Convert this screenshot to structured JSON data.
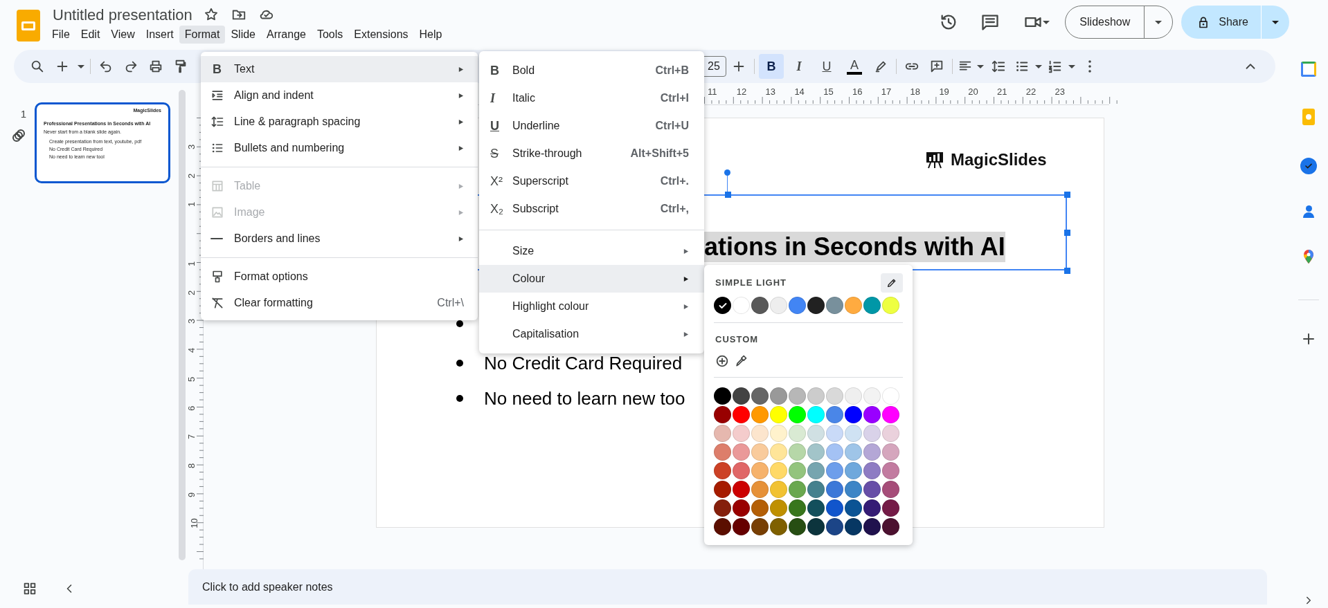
{
  "app": {
    "title": "Untitled presentation"
  },
  "menu_bar": [
    {
      "label": "File",
      "selected": false
    },
    {
      "label": "Edit",
      "selected": false
    },
    {
      "label": "View",
      "selected": false
    },
    {
      "label": "Insert",
      "selected": false
    },
    {
      "label": "Format",
      "selected": true
    },
    {
      "label": "Slide",
      "selected": false
    },
    {
      "label": "Arrange",
      "selected": false
    },
    {
      "label": "Tools",
      "selected": false
    },
    {
      "label": "Extensions",
      "selected": false
    },
    {
      "label": "Help",
      "selected": false
    }
  ],
  "header": {
    "slideshow_label": "Slideshow",
    "share_label": "Share"
  },
  "toolbar": {
    "font_size": "25",
    "format_buttons": [
      {
        "glyph": "B",
        "selected": true
      },
      {
        "glyph": "I",
        "selected": false
      },
      {
        "glyph": "U",
        "selected": false
      },
      {
        "glyph": "A",
        "selected": false
      }
    ]
  },
  "filmstrip": {
    "slides": [
      {
        "number": "1",
        "selected": true,
        "logo": "MagicSlides",
        "title": "Professional Presentations in Seconds with AI",
        "subtitle": "Never start from a blank slide again.",
        "bullets": [
          "Create presentation from text, youtube, pdf",
          "No Credit Card Required",
          "No need to learn new tool"
        ]
      }
    ]
  },
  "rulers": {
    "horizontal": [
      "11",
      "12",
      "13",
      "14",
      "15",
      "16",
      "17",
      "18",
      "19",
      "20",
      "21",
      "22",
      "23"
    ],
    "vertical_above": [
      "3",
      "2",
      "1"
    ],
    "vertical_below": [
      "1",
      "2",
      "3",
      "4",
      "5",
      "6",
      "7",
      "8",
      "9",
      "10"
    ]
  },
  "slide": {
    "logo": "MagicSlides",
    "title": {
      "text": "ations in Seconds with AI",
      "selected": true
    },
    "bullets": [
      {
        "kind": "covered"
      },
      {
        "kind": "text",
        "text": "No Credit Card Required"
      },
      {
        "kind": "text",
        "text": "No need to learn new too"
      }
    ]
  },
  "format_menu": {
    "groups": [
      [
        {
          "label": "Text",
          "glyph": "B",
          "submenu": true,
          "disabled": false,
          "selected": true
        },
        {
          "label": "Align and indent",
          "submenu": true,
          "disabled": false,
          "selected": false
        },
        {
          "label": "Line & paragraph spacing",
          "submenu": true,
          "disabled": false,
          "selected": false
        },
        {
          "label": "Bullets and numbering",
          "submenu": true,
          "disabled": false,
          "selected": false
        }
      ],
      [
        {
          "label": "Table",
          "submenu": true,
          "disabled": true,
          "selected": false
        },
        {
          "label": "Image",
          "submenu": true,
          "disabled": true,
          "selected": false
        },
        {
          "label": "Borders and lines",
          "submenu": true,
          "disabled": false,
          "selected": false
        }
      ],
      [
        {
          "label": "Format options",
          "submenu": false,
          "disabled": false,
          "selected": false
        },
        {
          "label": "Clear formatting",
          "shortcut": "Ctrl+\\",
          "submenu": false,
          "disabled": false,
          "selected": false
        }
      ]
    ]
  },
  "text_submenu": {
    "groups": [
      [
        {
          "label": "Bold",
          "glyph": "B",
          "shortcut": "Ctrl+B",
          "submenu": false,
          "selected": false
        },
        {
          "label": "Italic",
          "glyph": "I",
          "shortcut": "Ctrl+I",
          "submenu": false,
          "selected": false
        },
        {
          "label": "Underline",
          "glyph": "U",
          "shortcut": "Ctrl+U",
          "submenu": false,
          "selected": false
        },
        {
          "label": "Strike-through",
          "glyph": "S",
          "shortcut": "Alt+Shift+5",
          "submenu": false,
          "selected": false
        },
        {
          "label": "Superscript",
          "glyph": "X²",
          "shortcut": "Ctrl+.",
          "submenu": false,
          "selected": false
        },
        {
          "label": "Subscript",
          "glyph": "X₂",
          "shortcut": "Ctrl+,",
          "submenu": false,
          "selected": false
        }
      ],
      [
        {
          "label": "Size",
          "submenu": true,
          "selected": false
        },
        {
          "label": "Colour",
          "submenu": true,
          "selected": true
        },
        {
          "label": "Highlight colour",
          "submenu": true,
          "selected": false
        },
        {
          "label": "Capitalisation",
          "submenu": true,
          "selected": false
        }
      ]
    ]
  },
  "colour_palette": {
    "theme_label": "SIMPLE LIGHT",
    "theme_colours": [
      {
        "color": "#000000",
        "selected": true
      },
      {
        "color": "#ffffff",
        "selected": false
      },
      {
        "color": "#595959",
        "selected": false
      },
      {
        "color": "#eeeeee",
        "selected": false
      },
      {
        "color": "#4285f4",
        "selected": false
      },
      {
        "color": "#212121",
        "selected": false
      },
      {
        "color": "#78909c",
        "selected": false
      },
      {
        "color": "#ffab40",
        "selected": false
      },
      {
        "color": "#0097a7",
        "selected": false
      },
      {
        "color": "#eeff41",
        "selected": false
      }
    ],
    "custom_label": "CUSTOM",
    "rows": [
      [
        {
          "color": "#000000"
        },
        {
          "color": "#434343"
        },
        {
          "color": "#666666"
        },
        {
          "color": "#999999"
        },
        {
          "color": "#b7b7b7"
        },
        {
          "color": "#cccccc"
        },
        {
          "color": "#d9d9d9"
        },
        {
          "color": "#efefef"
        },
        {
          "color": "#f3f3f3"
        },
        {
          "color": "#ffffff"
        }
      ],
      [
        {
          "color": "#980000"
        },
        {
          "color": "#ff0000"
        },
        {
          "color": "#ff9900"
        },
        {
          "color": "#ffff00"
        },
        {
          "color": "#00ff00"
        },
        {
          "color": "#00ffff"
        },
        {
          "color": "#4a86e8"
        },
        {
          "color": "#0000ff"
        },
        {
          "color": "#9900ff"
        },
        {
          "color": "#ff00ff"
        }
      ],
      [
        {
          "color": "#e6b8af"
        },
        {
          "color": "#f4cccc"
        },
        {
          "color": "#fce5cd"
        },
        {
          "color": "#fff2cc"
        },
        {
          "color": "#d9ead3"
        },
        {
          "color": "#d0e0e3"
        },
        {
          "color": "#c9daf8"
        },
        {
          "color": "#cfe2f3"
        },
        {
          "color": "#d9d2e9"
        },
        {
          "color": "#ead1dc"
        }
      ],
      [
        {
          "color": "#dd7e6b"
        },
        {
          "color": "#ea9999"
        },
        {
          "color": "#f9cb9c"
        },
        {
          "color": "#ffe599"
        },
        {
          "color": "#b6d7a8"
        },
        {
          "color": "#a2c4c9"
        },
        {
          "color": "#a4c2f4"
        },
        {
          "color": "#9fc5e8"
        },
        {
          "color": "#b4a7d6"
        },
        {
          "color": "#d5a6bd"
        }
      ],
      [
        {
          "color": "#cc4125"
        },
        {
          "color": "#e06666"
        },
        {
          "color": "#f6b26b"
        },
        {
          "color": "#ffd966"
        },
        {
          "color": "#93c47d"
        },
        {
          "color": "#76a5af"
        },
        {
          "color": "#6d9eeb"
        },
        {
          "color": "#6fa8dc"
        },
        {
          "color": "#8e7cc3"
        },
        {
          "color": "#c27ba0"
        }
      ],
      [
        {
          "color": "#a61c00"
        },
        {
          "color": "#cc0000"
        },
        {
          "color": "#e69138"
        },
        {
          "color": "#f1c232"
        },
        {
          "color": "#6aa84f"
        },
        {
          "color": "#45818e"
        },
        {
          "color": "#3c78d8"
        },
        {
          "color": "#3d85c6"
        },
        {
          "color": "#674ea7"
        },
        {
          "color": "#a64d79"
        }
      ],
      [
        {
          "color": "#85200c"
        },
        {
          "color": "#990000"
        },
        {
          "color": "#b45f06"
        },
        {
          "color": "#bf9000"
        },
        {
          "color": "#38761d"
        },
        {
          "color": "#134f5c"
        },
        {
          "color": "#1155cc"
        },
        {
          "color": "#0b5394"
        },
        {
          "color": "#351c75"
        },
        {
          "color": "#741b47"
        }
      ],
      [
        {
          "color": "#5b0f00"
        },
        {
          "color": "#660000"
        },
        {
          "color": "#783f04"
        },
        {
          "color": "#7f6000"
        },
        {
          "color": "#274e13"
        },
        {
          "color": "#0c343d"
        },
        {
          "color": "#1c4587"
        },
        {
          "color": "#073763"
        },
        {
          "color": "#20124d"
        },
        {
          "color": "#4c1130"
        }
      ]
    ]
  },
  "speaker_notes": {
    "placeholder": "Click to add speaker notes"
  }
}
